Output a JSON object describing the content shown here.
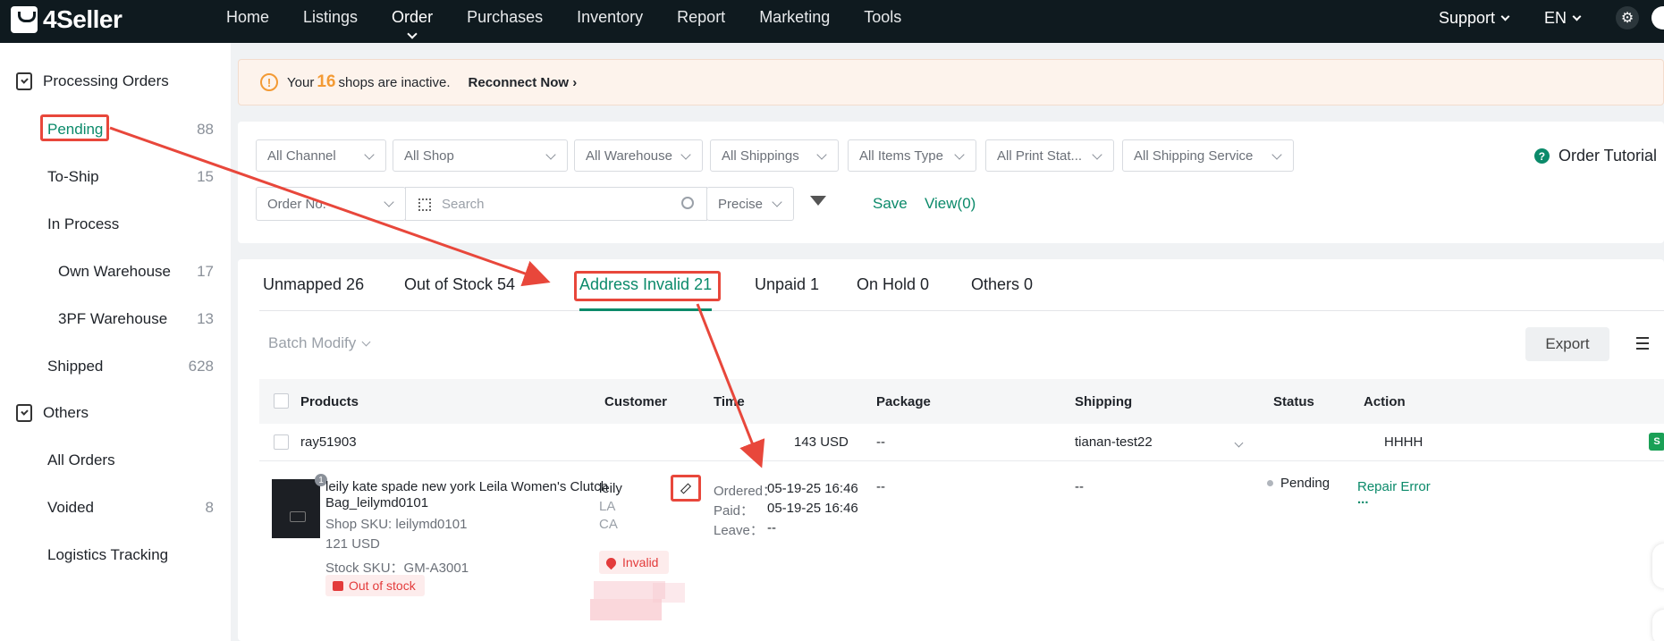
{
  "app": {
    "name": "4Seller"
  },
  "nav": {
    "items": [
      "Home",
      "Listings",
      "Order",
      "Purchases",
      "Inventory",
      "Report",
      "Marketing",
      "Tools"
    ],
    "active": "Order",
    "support": "Support",
    "language": "EN"
  },
  "sidebar": {
    "processing_title": "Processing Orders",
    "items": [
      {
        "label": "Pending",
        "count": "88"
      },
      {
        "label": "To-Ship",
        "count": "15"
      },
      {
        "label": "In Process",
        "count": ""
      },
      {
        "label": "Own Warehouse",
        "count": "17"
      },
      {
        "label": "3PF Warehouse",
        "count": "13"
      },
      {
        "label": "Shipped",
        "count": "628"
      }
    ],
    "others_title": "Others",
    "others": [
      {
        "label": "All Orders",
        "count": ""
      },
      {
        "label": "Voided",
        "count": "8"
      },
      {
        "label": "Logistics Tracking",
        "count": ""
      }
    ]
  },
  "banner": {
    "prefix": "Your",
    "count": "16",
    "suffix": "shops are inactive.",
    "link": "Reconnect Now"
  },
  "filters": {
    "selects": [
      "All Channel",
      "All Shop",
      "All Warehouse",
      "All Shippings",
      "All Items Type",
      "All Print Stat...",
      "All Shipping Service"
    ],
    "tutorial": "Order Tutorial",
    "search_type": "Order No.",
    "search_placeholder": "Search",
    "match": "Precise",
    "save": "Save",
    "view": "View(0)"
  },
  "tabs": [
    "Unmapped 26",
    "Out of Stock 54",
    "Address Invalid 21",
    "Unpaid 1",
    "On Hold 0",
    "Others 0"
  ],
  "toolbar": {
    "batch": "Batch Modify",
    "export": "Export"
  },
  "table": {
    "headers": [
      "Products",
      "Customer",
      "Time",
      "Package",
      "Shipping",
      "Status",
      "Action"
    ],
    "group": {
      "order_id": "ray51903",
      "amount": "143 USD",
      "package": "--",
      "shipping_account": "tianan-test22",
      "shop": "HHHH"
    },
    "row": {
      "img_badge": "1",
      "title_line1": "leily kate spade new york Leila Women's Clutch",
      "title_line2": "Bag_leilymd0101",
      "shop_sku": "Shop SKU: leilymd0101",
      "price": "121 USD",
      "stock_sku": "Stock SKU：GM-A3001",
      "stock_badge": "Out of stock",
      "customer_name": "leily",
      "city": "LA",
      "state": "CA",
      "address_badge": "Invalid",
      "ordered_label": "Ordered：",
      "ordered": "05-19-25 16:46",
      "paid_label": "Paid：",
      "paid": "05-19-25 16:46",
      "leave_label": "Leave：",
      "leave": "--",
      "package": "--",
      "shipping": "--",
      "status": "Pending",
      "action": "Repair Error",
      "more": "..."
    }
  },
  "colors": {
    "brand": "#0b8a6a",
    "annotation": "#e8473b",
    "warning": "#f39a34",
    "error": "#e33b3b"
  }
}
